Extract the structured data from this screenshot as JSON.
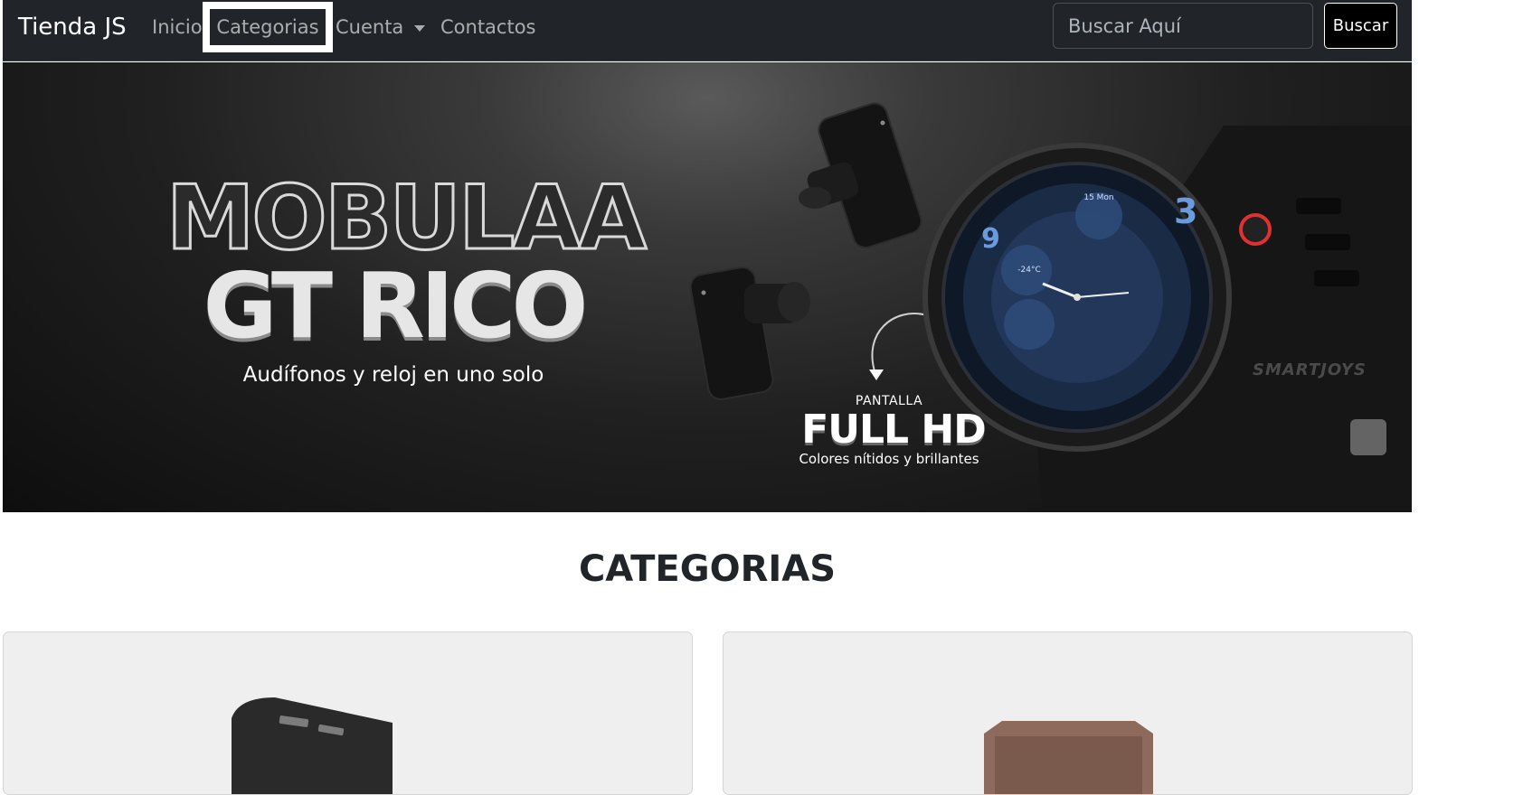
{
  "navbar": {
    "brand": "Tienda JS",
    "links": [
      {
        "label": "Inicio"
      },
      {
        "label": "Categorias"
      },
      {
        "label": "Cuenta"
      },
      {
        "label": "Contactos"
      }
    ],
    "search_placeholder": "Buscar Aquí",
    "search_button": "Buscar"
  },
  "hero": {
    "title_line1": "MOBULAA",
    "title_line2": "GT RICO",
    "subtitle": "Audífonos y reloj en uno solo",
    "feature_label": "PANTALLA",
    "feature_title": "FULL HD",
    "feature_text": "Colores nítidos y brillantes",
    "watermark": "SMARTJOYS",
    "watch_face_date": "15 Mon",
    "watch_face_temp": "-24°C"
  },
  "section": {
    "title": "CATEGORIAS"
  },
  "cards": [
    {
      "image": "power-bank"
    },
    {
      "image": "watch-strap"
    }
  ],
  "colors": {
    "navbar_bg": "#212529",
    "highlight_border": "#ffffff",
    "watch_accent": "#6b9bdc",
    "crown_red": "#e03030"
  }
}
